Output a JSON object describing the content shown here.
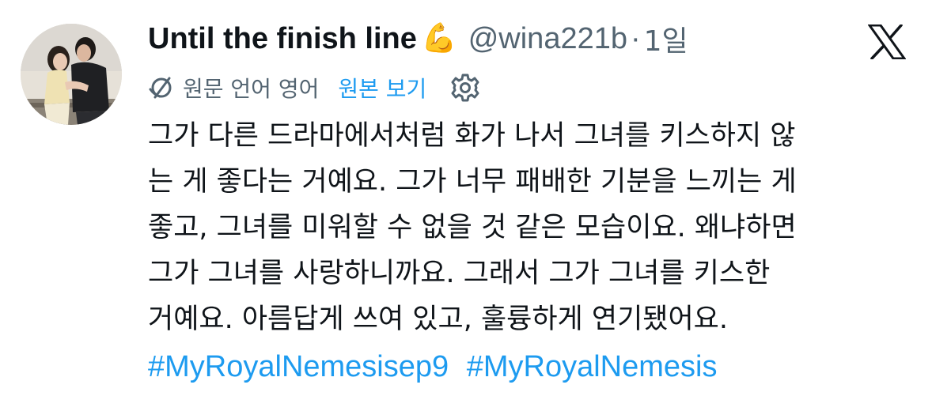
{
  "author": {
    "display_name": "Until the finish line",
    "emoji": "💪",
    "handle": "@wina221b",
    "separator": "·",
    "time": "1일",
    "avatar": "avatar-photo"
  },
  "translation": {
    "icon": "translate-icon",
    "label": "원문 언어 영어",
    "view_original_label": "원본 보기",
    "settings_icon": "gear-icon"
  },
  "tweet": {
    "lines": [
      "그가 다른 드라마에서처럼 화가 나서 그녀를 키스하지 않",
      "는 게 좋다는 거예요. 그가 너무 패배한 기분을 느끼는 게",
      "좋고, 그녀를 미워할 수 없을 것 같은 모습이요. 왜냐하면",
      "그가 그녀를 사랑하니까요. 그래서 그가 그녀를 키스한",
      "거예요. 아름답게 쓰여 있고, 훌륭하게 연기됐어요."
    ],
    "hashtags": [
      "#MyRoyalNemesisep9",
      "#MyRoyalNemesis"
    ]
  },
  "brand": {
    "logo_icon": "x-logo-icon"
  },
  "colors": {
    "text": "#0f1419",
    "secondary": "#536471",
    "link": "#1d9bf0",
    "background": "#ffffff"
  }
}
